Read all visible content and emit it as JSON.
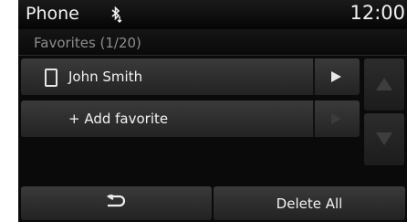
{
  "status_bar": {
    "title": "Phone",
    "time": "12:00",
    "bluetooth_icon": "bluetooth-icon"
  },
  "header": {
    "subtitle": "Favorites (1/20)"
  },
  "favorites": [
    {
      "label": "John Smith",
      "icon": "phone-icon",
      "action_icon": "play-arrow-icon",
      "enabled": true
    },
    {
      "label": "+ Add favorite",
      "action_icon": "play-arrow-icon",
      "enabled": false
    }
  ],
  "scroll": {
    "up_icon": "up-arrow-icon",
    "down_icon": "down-arrow-icon",
    "enabled": false
  },
  "bottom_bar": {
    "back_icon": "back-icon",
    "delete_label": "Delete All"
  },
  "colors": {
    "background": "#0a0a0a",
    "button": "#2f2f2f",
    "text": "#f2f2f2",
    "muted_text": "#8d8d8d",
    "disabled": "#3b3b3b"
  }
}
